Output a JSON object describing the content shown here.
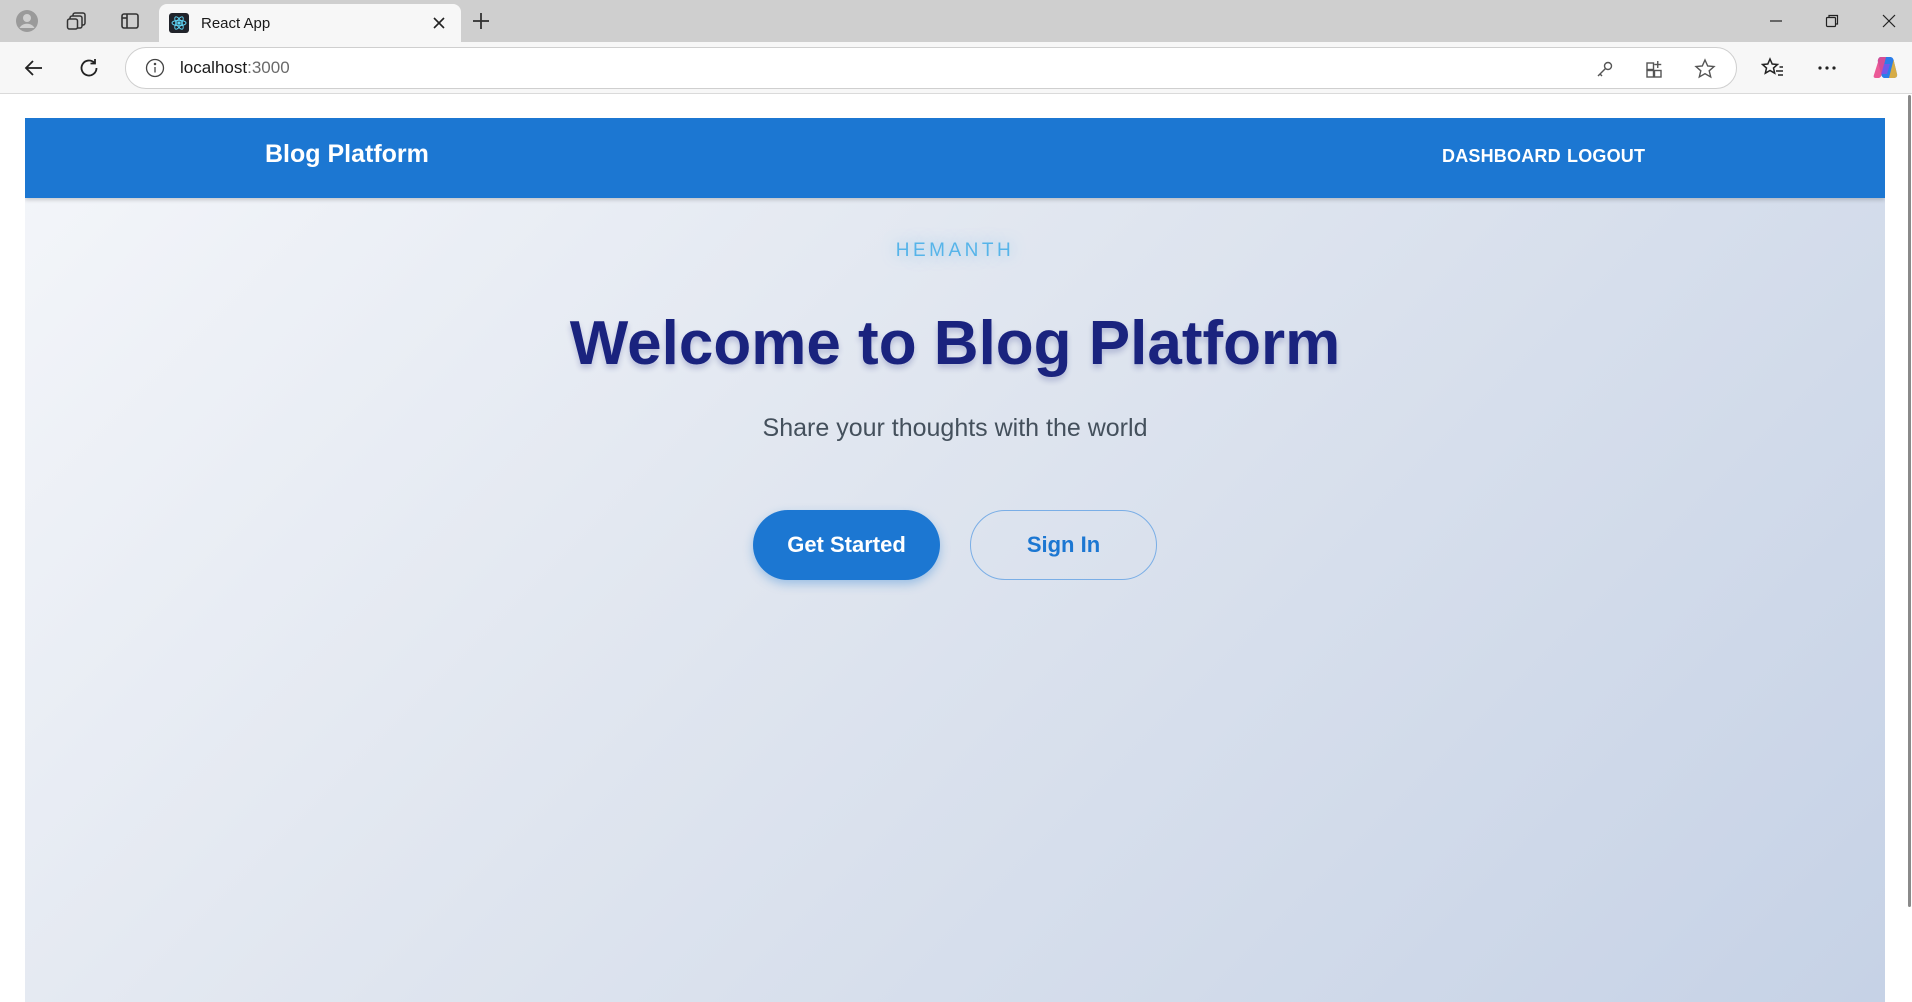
{
  "browser": {
    "tab_title": "React App",
    "url_host": "localhost",
    "url_port": ":3000"
  },
  "app": {
    "brand": "Blog Platform",
    "nav": {
      "dashboard": "DASHBOARD",
      "logout": "LOGOUT"
    },
    "hero": {
      "eyebrow": "HEMANTH",
      "title": "Welcome to Blog Platform",
      "subtitle": "Share your thoughts with the world",
      "primary_button": "Get Started",
      "secondary_button": "Sign In"
    }
  },
  "colors": {
    "appbar": "#1c77d2",
    "headline": "#1a237e",
    "eyebrow": "#56b4e9"
  }
}
